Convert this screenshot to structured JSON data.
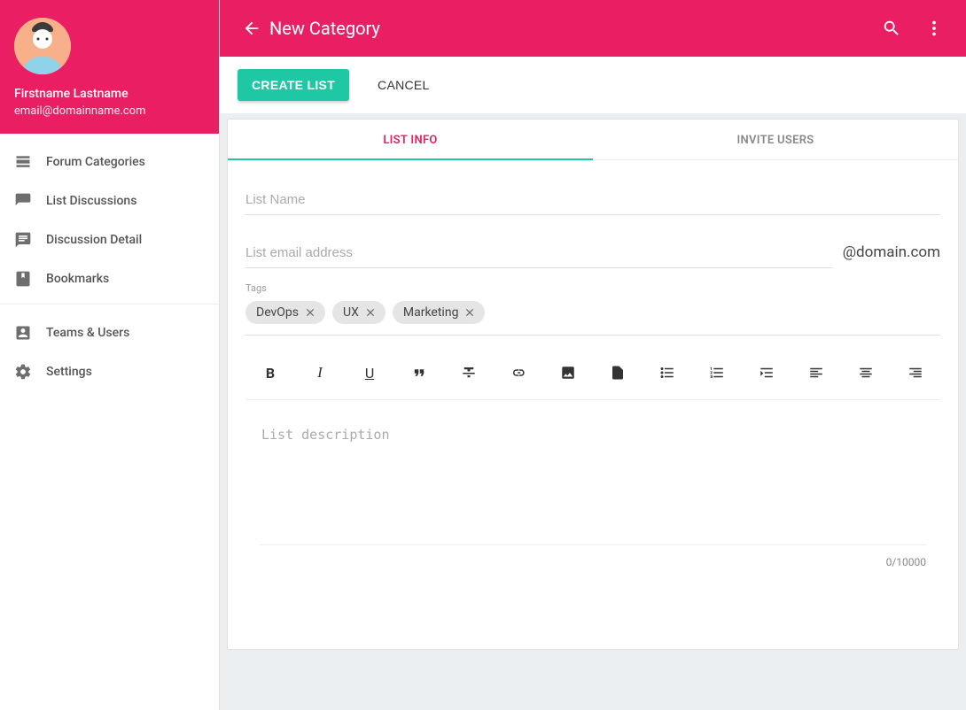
{
  "colors": {
    "primary": "#e91e63",
    "accent": "#1ec8a5"
  },
  "user": {
    "name": "Firstname Lastname",
    "email": "email@domainname.com"
  },
  "sidebar": {
    "group1": [
      {
        "icon": "forum-categories-icon",
        "label": "Forum Categories"
      },
      {
        "icon": "list-discussions-icon",
        "label": "List Discussions"
      },
      {
        "icon": "discussion-detail-icon",
        "label": "Discussion Detail"
      },
      {
        "icon": "bookmarks-icon",
        "label": "Bookmarks"
      }
    ],
    "group2": [
      {
        "icon": "teams-users-icon",
        "label": "Teams & Users"
      },
      {
        "icon": "settings-icon",
        "label": "Settings"
      }
    ]
  },
  "appbar": {
    "title": "New Category",
    "search_icon": "search-icon",
    "more_icon": "more-vert-icon",
    "back_icon": "arrow-back-icon"
  },
  "actions": {
    "primary": "CREATE LIST",
    "cancel": "CANCEL"
  },
  "tabs": {
    "list_info": "LIST INFO",
    "invite_users": "INVITE USERS"
  },
  "form": {
    "list_name_placeholder": "List Name",
    "list_name_value": "",
    "list_email_placeholder": "List email address",
    "list_email_value": "",
    "email_domain_suffix": "@domain.com",
    "tags_label": "Tags",
    "tags": [
      "DevOps",
      "UX",
      "Marketing"
    ],
    "description_placeholder": "List description",
    "description_value": "",
    "char_counter": "0/10000"
  },
  "richtext_toolbar": [
    "bold",
    "italic",
    "underline",
    "quote",
    "strikethrough",
    "link",
    "image",
    "file",
    "bullet-list",
    "numbered-list",
    "indent-list",
    "align-left",
    "align-center",
    "align-right"
  ]
}
